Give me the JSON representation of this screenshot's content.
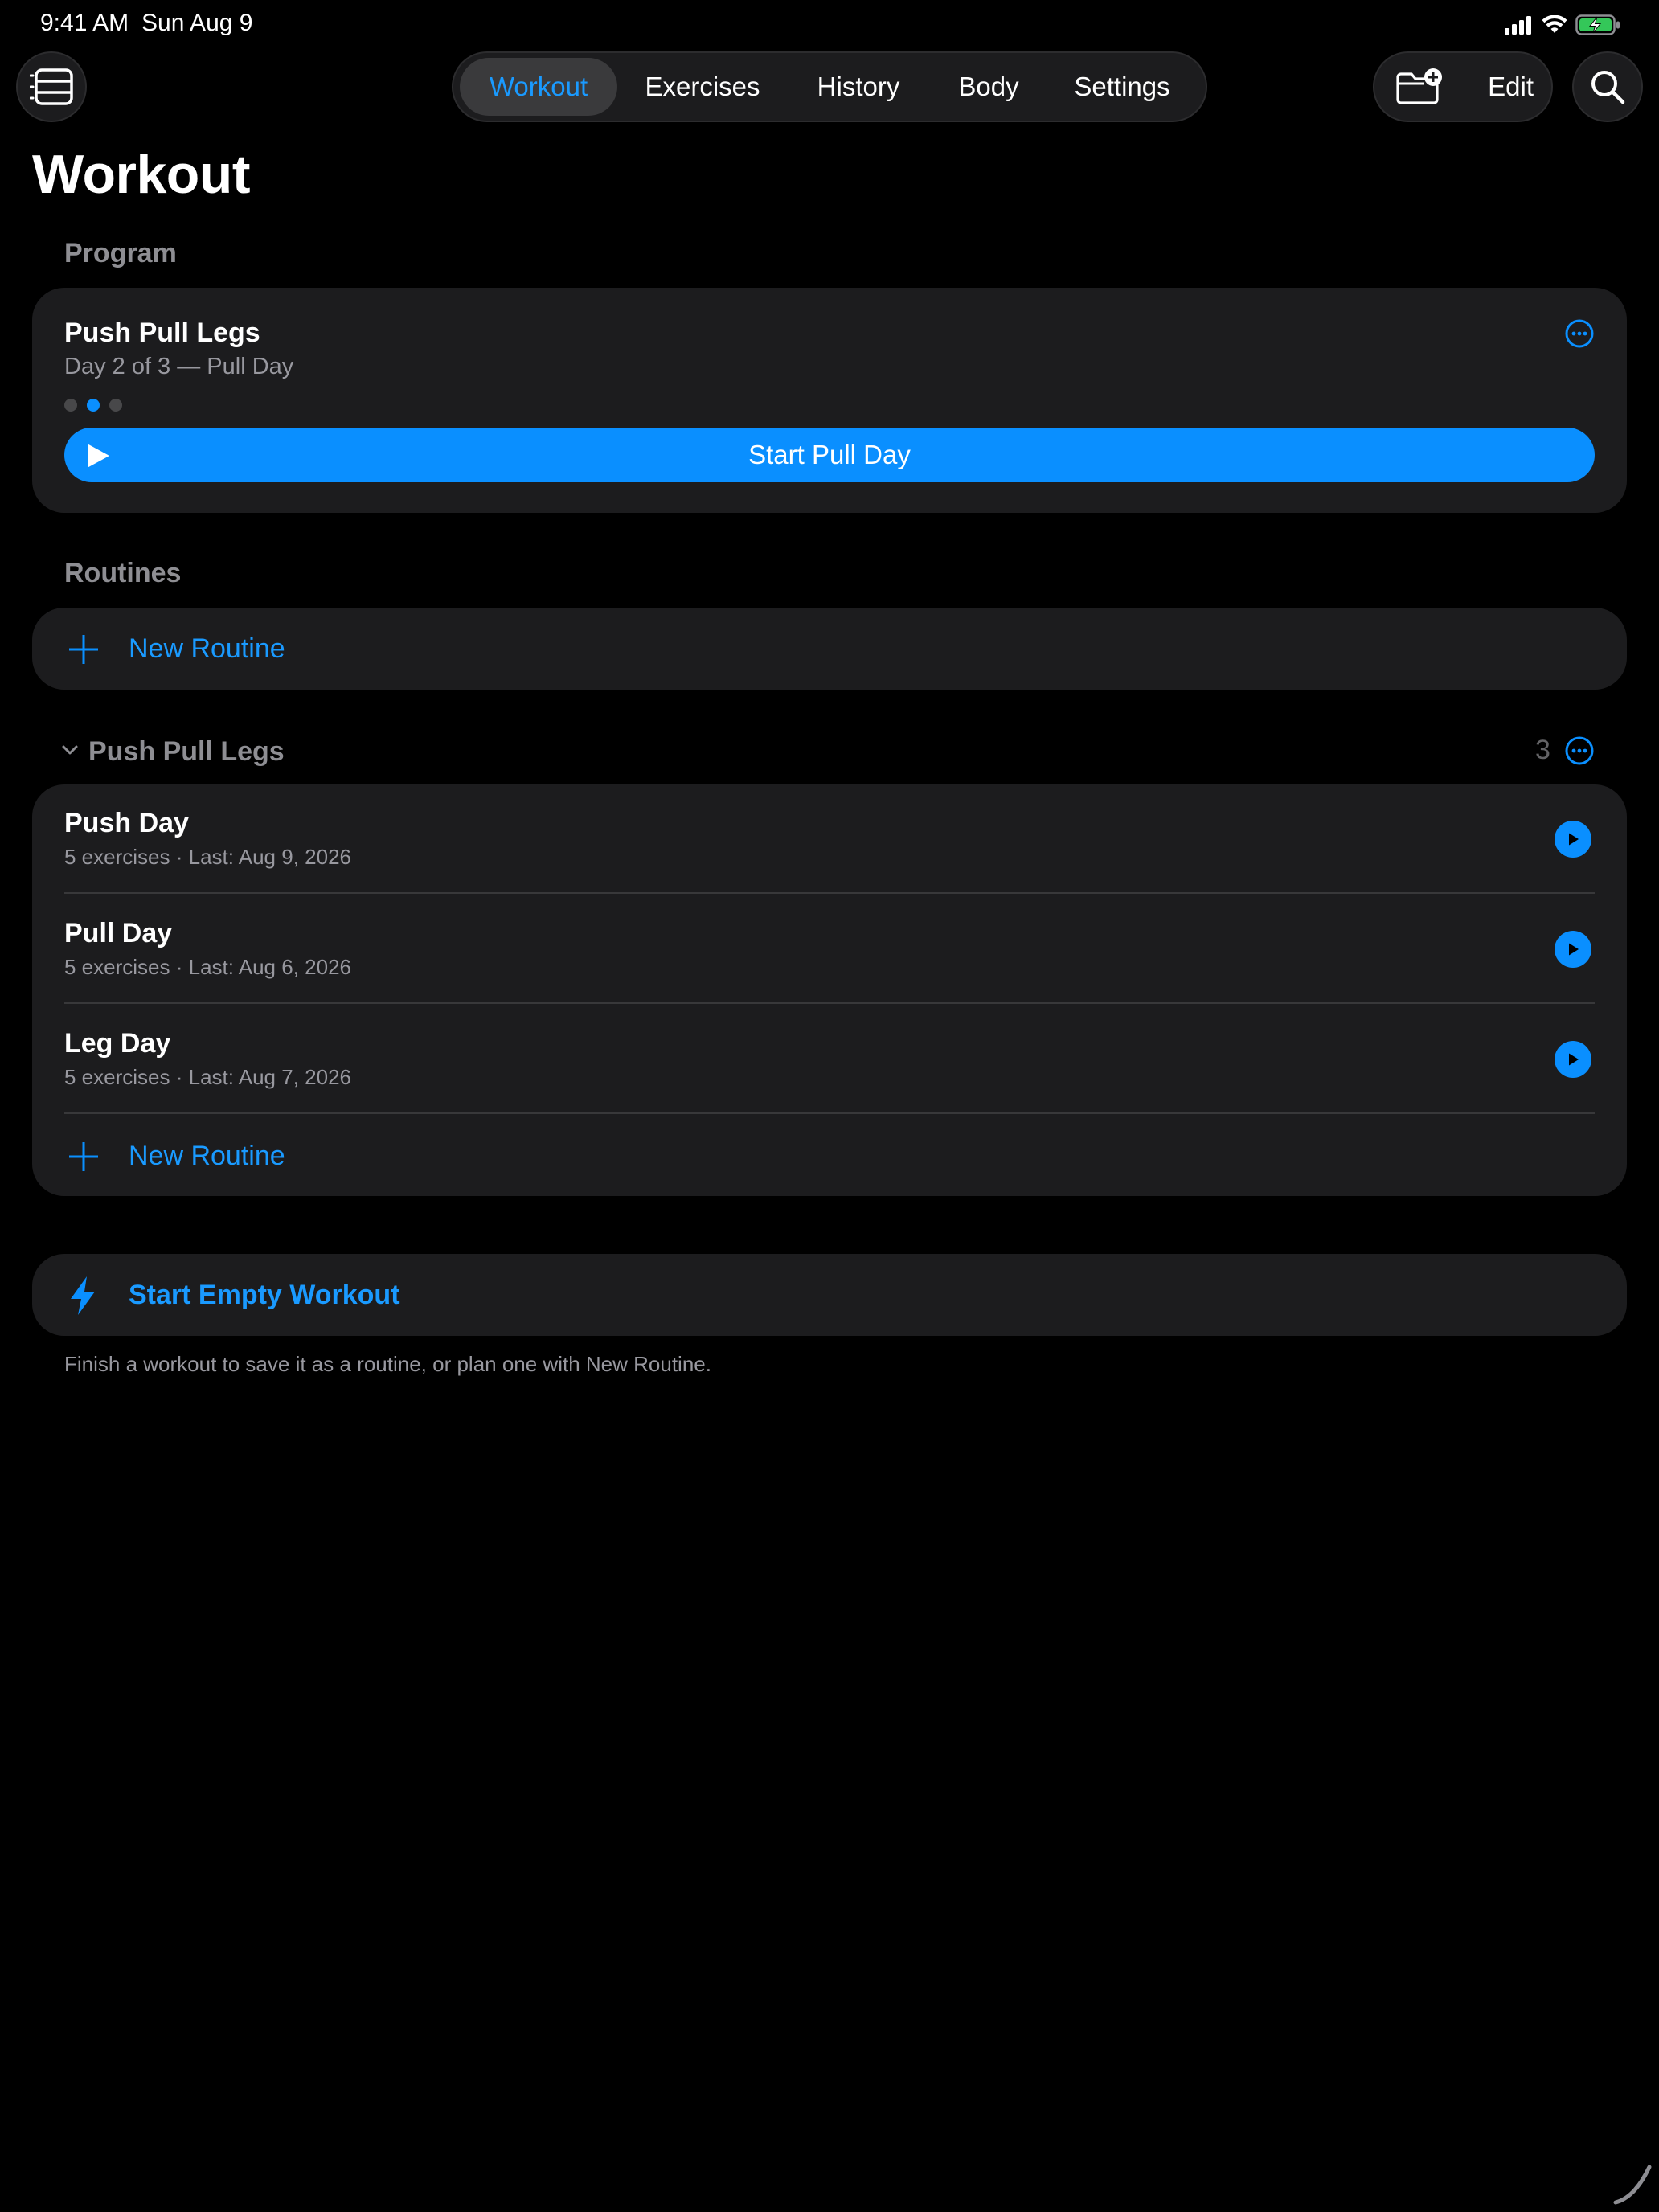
{
  "status_bar": {
    "time": "9:41 AM",
    "date": "Sun Aug 9",
    "icons": [
      "cellular-signal-icon",
      "wifi-icon",
      "battery-charging-icon"
    ]
  },
  "nav": {
    "sidebar_icon": "sidebar-icon",
    "tabs": [
      {
        "label": "Workout",
        "active": true
      },
      {
        "label": "Exercises",
        "active": false
      },
      {
        "label": "History",
        "active": false
      },
      {
        "label": "Body",
        "active": false
      },
      {
        "label": "Settings",
        "active": false
      }
    ],
    "new_folder_icon": "folder-add-icon",
    "edit_label": "Edit",
    "search_icon": "search-icon"
  },
  "page": {
    "title": "Workout"
  },
  "program": {
    "section_label": "Program",
    "name": "Push Pull Legs",
    "progress_text": "Day 2 of 3 — Pull Day",
    "current_day": 2,
    "total_days": 3,
    "start_label": "Start Pull Day"
  },
  "routines": {
    "section_label": "Routines",
    "new_routine_label": "New Routine"
  },
  "folder": {
    "name": "Push Pull Legs",
    "count": "3",
    "items": [
      {
        "name": "Push Day",
        "detail": "5 exercises · Last: Aug 9, 2026"
      },
      {
        "name": "Pull Day",
        "detail": "5 exercises · Last: Aug 6, 2026"
      },
      {
        "name": "Leg Day",
        "detail": "5 exercises · Last: Aug 7, 2026"
      }
    ],
    "new_routine_label": "New Routine"
  },
  "empty_workout": {
    "label": "Start Empty Workout",
    "note": "Finish a workout to save it as a routine, or plan one with New Routine."
  },
  "colors": {
    "accent": "#0a8fff",
    "background": "#000000",
    "card": "#1c1c1e",
    "secondary_text": "#98989f",
    "battery": "#34c759"
  }
}
